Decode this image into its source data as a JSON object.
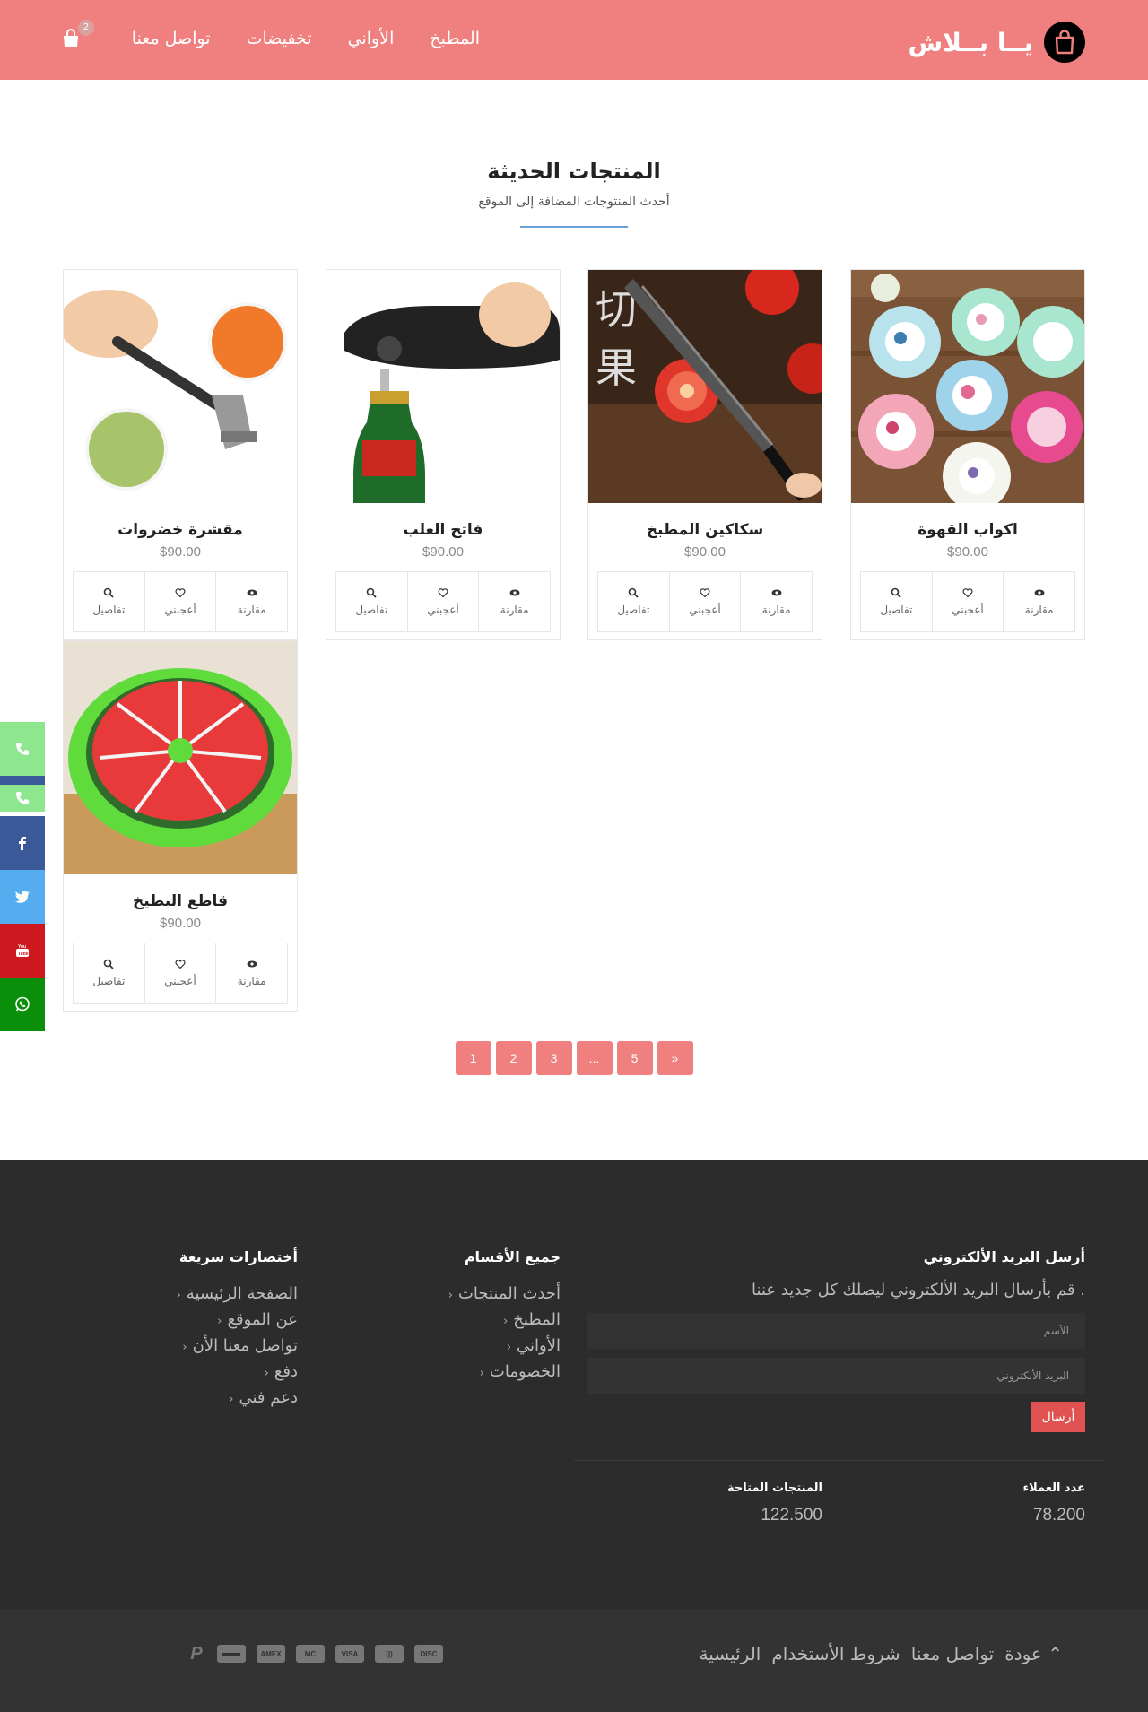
{
  "header": {
    "brand": "يــا بــلاش",
    "nav": [
      "المطبخ",
      "الأواني",
      "تخفيضات",
      "تواصل معنا"
    ],
    "cart_count": "2"
  },
  "section": {
    "title": "المنتجات الحديثة",
    "subtitle": "أحدث المنتوجات المضافة إلى الموقع"
  },
  "products": [
    {
      "name": "اكواب القهوة",
      "price": "$90.00",
      "image": "coffee-cups"
    },
    {
      "name": "سكاكين المطبخ",
      "price": "$90.00",
      "image": "kitchen-knife"
    },
    {
      "name": "فاتح العلب",
      "price": "$90.00",
      "image": "can-opener"
    },
    {
      "name": "مقشرة خضروات",
      "price": "$90.00",
      "image": "vegetable-peeler"
    },
    {
      "name": "قاطع البطيخ",
      "price": "$90.00",
      "image": "watermelon-slicer"
    }
  ],
  "product_actions": {
    "compare": "مقارنة",
    "like": "أعجبني",
    "details": "تفاصيل"
  },
  "pagination": [
    "1",
    "2",
    "3",
    "...",
    "5",
    "»"
  ],
  "social": [
    "phone",
    "phone",
    "facebook",
    "twitter",
    "youtube",
    "whatsapp"
  ],
  "footer": {
    "newsletter_title": "أرسل البريد الألكتروني",
    "newsletter_text": ". قم بأرسال البريد الألكتروني ليصلك كل جديد عننا",
    "name_placeholder": "الأسم",
    "email_placeholder": "البريد الألكتروني",
    "send": "أرسال",
    "categories_title": "جميع الأقسام",
    "categories": [
      "أحدث المنتجات",
      "المطبخ",
      "الأواني",
      "الخصومات"
    ],
    "shortcuts_title": "أختصارات سريعة",
    "shortcuts": [
      "الصفحة الرئيسية",
      "عن الموقع",
      "تواصل معنا الأن",
      "دفع",
      "دعم فني"
    ],
    "customers_label": "عدد العملاء",
    "customers_value": "78.200",
    "products_label": "المنتجات المتاحة",
    "products_value": "122.500",
    "bottom_links": [
      "عودة",
      "تواصل معنا",
      "شروط الأستخدام",
      "الرئيسية"
    ],
    "payment_methods": [
      "DISCOVER",
      "DINERS",
      "VISA",
      "MC",
      "AMEX",
      "CARD",
      "PayPal"
    ]
  }
}
